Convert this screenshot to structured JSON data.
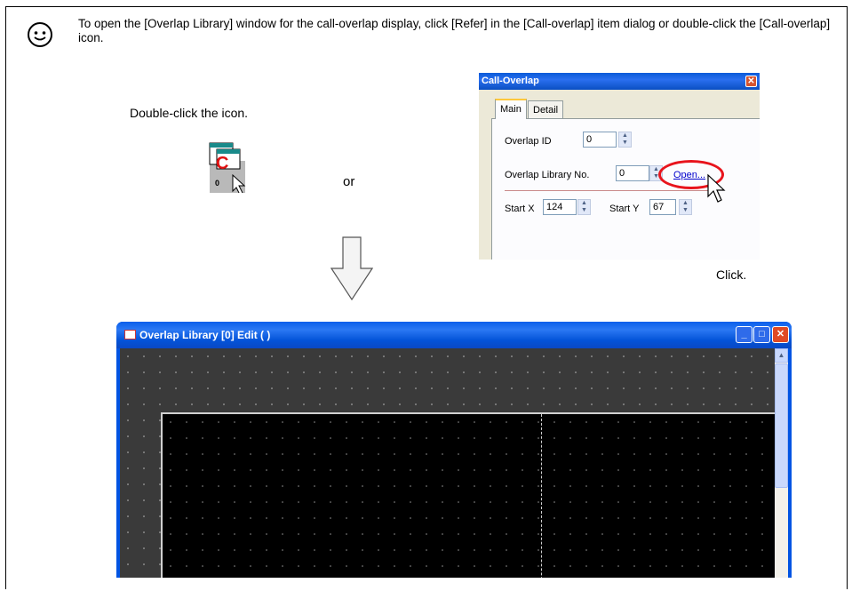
{
  "intro": {
    "text": "To open the [Overlap Library] window for the call-overlap display, click [Refer] in the [Call-overlap] item dialog or double-click the [Call-overlap] icon."
  },
  "captions": {
    "double_click": "Double-click the icon.",
    "or": "or",
    "click": "Click."
  },
  "call_icon": {
    "number": "0",
    "letter": "C"
  },
  "dialog": {
    "title": "Call-Overlap",
    "close_glyph": "✕",
    "tabs": [
      {
        "label": "Main"
      },
      {
        "label": "Detail"
      }
    ],
    "overlap_id_label": "Overlap ID",
    "overlap_id_value": "0",
    "library_no_label": "Overlap Library No.",
    "library_no_value": "0",
    "open_label": "Open...",
    "start_x_label": "Start X",
    "start_x_value": "124",
    "start_y_label": "Start Y",
    "start_y_value": "67"
  },
  "window": {
    "title": "Overlap Library [0] Edit (                )",
    "min_glyph": "_",
    "max_glyph": "□",
    "close_glyph": "✕"
  },
  "colors": {
    "highlight_ring": "#e8141c",
    "xp_blue": "#0054e3"
  }
}
